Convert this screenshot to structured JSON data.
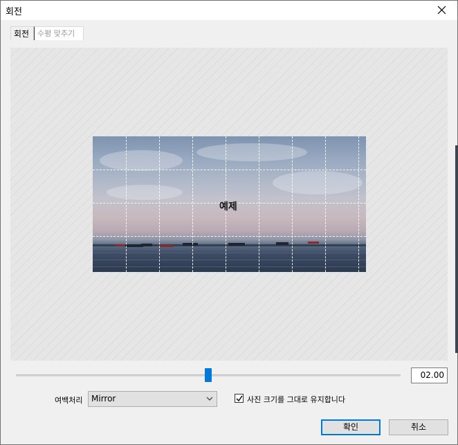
{
  "window": {
    "title": "회전",
    "close_icon": "close-icon"
  },
  "tabs": [
    {
      "label": "회전",
      "active": true
    },
    {
      "label": "수평 맞추기",
      "active": false
    }
  ],
  "preview": {
    "overlay_label": "예제"
  },
  "rotation": {
    "slider_value_fraction": 0.5,
    "value_text": "02.00",
    "accent_color": "#0078d7"
  },
  "margin": {
    "label": "여백처리",
    "selected": "Mirror"
  },
  "keep_size": {
    "checked": true,
    "label": "사진 크기를 그대로 유지합니다"
  },
  "buttons": {
    "ok_label": "확인",
    "cancel_label": "취소"
  }
}
